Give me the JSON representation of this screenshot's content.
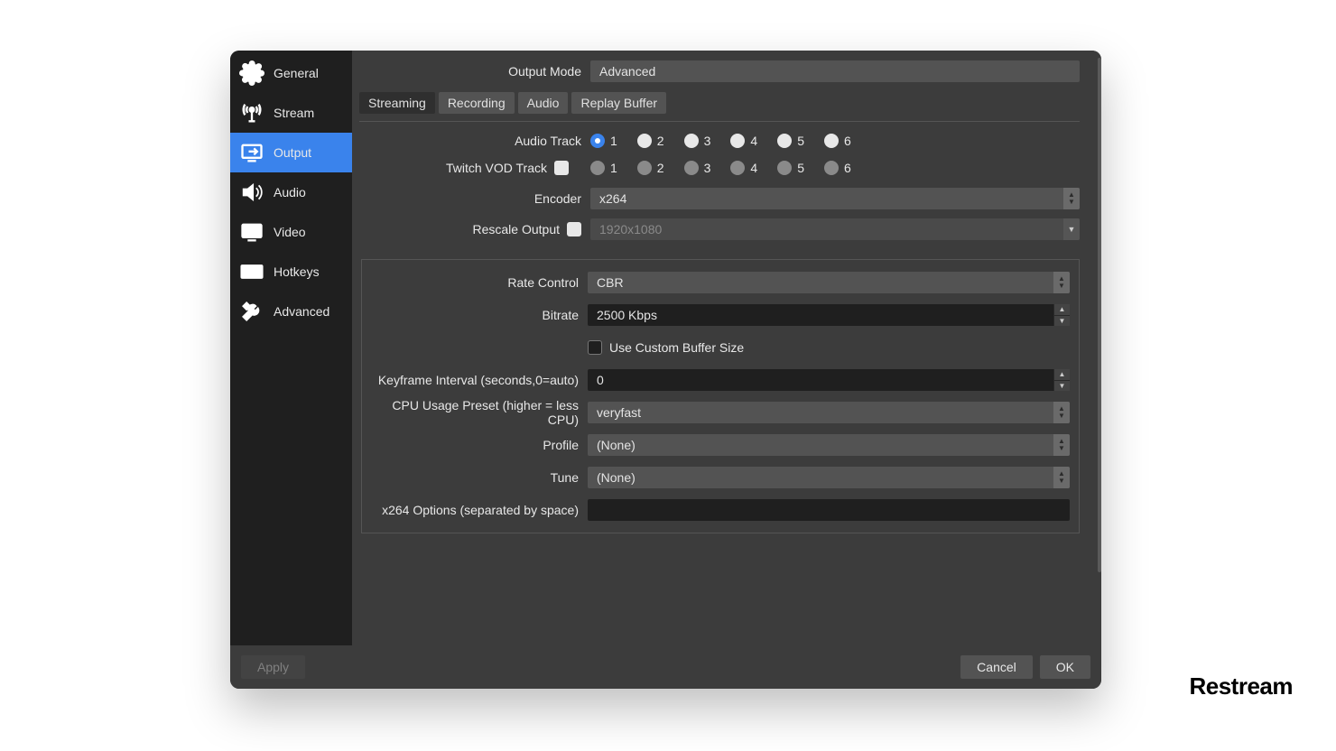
{
  "sidebar": {
    "items": [
      {
        "label": "General"
      },
      {
        "label": "Stream"
      },
      {
        "label": "Output"
      },
      {
        "label": "Audio"
      },
      {
        "label": "Video"
      },
      {
        "label": "Hotkeys"
      },
      {
        "label": "Advanced"
      }
    ]
  },
  "main": {
    "output_mode_label": "Output Mode",
    "output_mode_value": "Advanced",
    "tabs": [
      {
        "label": "Streaming"
      },
      {
        "label": "Recording"
      },
      {
        "label": "Audio"
      },
      {
        "label": "Replay Buffer"
      }
    ],
    "audio_track_label": "Audio Track",
    "audio_tracks": [
      "1",
      "2",
      "3",
      "4",
      "5",
      "6"
    ],
    "audio_track_selected": "1",
    "twitch_vod_label": "Twitch VOD Track",
    "twitch_vod_tracks": [
      "1",
      "2",
      "3",
      "4",
      "5",
      "6"
    ],
    "encoder_label": "Encoder",
    "encoder_value": "x264",
    "rescale_label": "Rescale Output",
    "rescale_placeholder": "1920x1080",
    "panel": {
      "rate_control_label": "Rate Control",
      "rate_control_value": "CBR",
      "bitrate_label": "Bitrate",
      "bitrate_value": "2500 Kbps",
      "custom_buffer_label": "Use Custom Buffer Size",
      "keyframe_label": "Keyframe Interval (seconds,0=auto)",
      "keyframe_value": "0",
      "cpu_preset_label": "CPU Usage Preset (higher = less CPU)",
      "cpu_preset_value": "veryfast",
      "profile_label": "Profile",
      "profile_value": "(None)",
      "tune_label": "Tune",
      "tune_value": "(None)",
      "x264_opts_label": "x264 Options (separated by space)",
      "x264_opts_value": ""
    }
  },
  "footer": {
    "apply": "Apply",
    "cancel": "Cancel",
    "ok": "OK"
  },
  "watermark": "Restream"
}
